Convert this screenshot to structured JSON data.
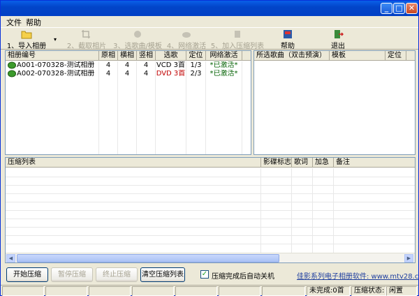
{
  "menu": {
    "items": [
      "文件",
      "帮助"
    ]
  },
  "toolbar": {
    "buttons": [
      {
        "label": "1、导入相册",
        "icon": "folder-icon"
      },
      {
        "label": "2、截取相片",
        "icon": "crop-icon"
      },
      {
        "label": "3、选歌曲/模板",
        "icon": "music-icon"
      },
      {
        "label": "4、网络激活",
        "icon": "cloud-icon"
      },
      {
        "label": "5、加入压缩列表",
        "icon": "add-list-icon"
      },
      {
        "label": "帮助",
        "icon": "help-book-icon"
      },
      {
        "label": "退出",
        "icon": "exit-door-icon"
      }
    ]
  },
  "album_table": {
    "headers": [
      "相册编号",
      "原相",
      "横相",
      "竖相",
      "选歌",
      "定位",
      "网络激活"
    ],
    "rows": [
      {
        "id": "A001-070328-测试相册",
        "orig": "4",
        "horiz": "4",
        "vert": "4",
        "song": "VCD 3首",
        "pos": "1/3",
        "activation": "*已激活*",
        "song_color": "#000000"
      },
      {
        "id": "A002-070328-测试相册",
        "orig": "4",
        "horiz": "4",
        "vert": "4",
        "song": "DVD 3首",
        "pos": "2/3",
        "activation": "*已激活*",
        "song_color": "#C00000"
      }
    ]
  },
  "song_table": {
    "headers": [
      "所选歌曲（双击预演）",
      "模板",
      "定位"
    ]
  },
  "compress_table": {
    "headers": [
      "压缩列表",
      "影碟标志",
      "歌词",
      "加急",
      "备注"
    ]
  },
  "buttons": {
    "start": "开始压缩",
    "pause": "暂停压缩",
    "stop": "终止压缩",
    "clear": "清空压缩列表"
  },
  "auto_shutdown": {
    "label": "压缩完成后自动关机",
    "checked": true
  },
  "link_text": "佳影系列电子相册软件: www.mtv28.com",
  "status": {
    "incomplete": "未完成:0首",
    "state_label": "压缩状态:",
    "state_value": "闲置"
  }
}
